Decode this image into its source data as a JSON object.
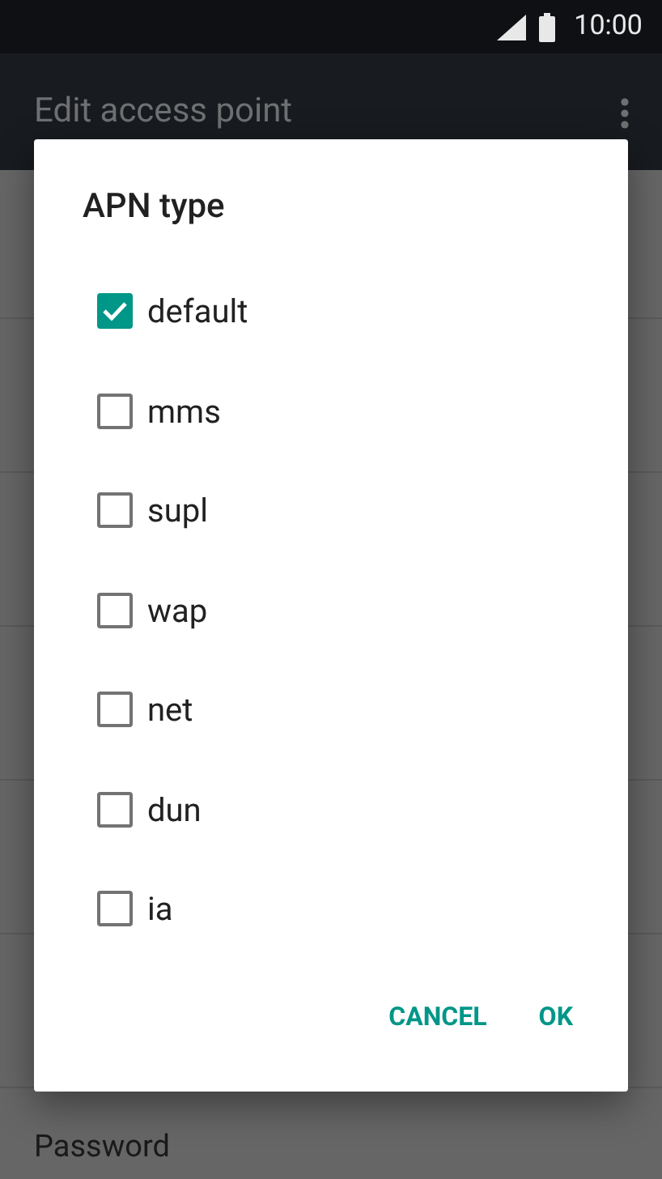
{
  "status_bar": {
    "time": "10:00"
  },
  "toolbar": {
    "title": "Edit access point"
  },
  "background_list": {
    "visible_item": "Password"
  },
  "dialog": {
    "title": "APN type",
    "options": [
      {
        "label": "default",
        "checked": true
      },
      {
        "label": "mms",
        "checked": false
      },
      {
        "label": "supl",
        "checked": false
      },
      {
        "label": "wap",
        "checked": false
      },
      {
        "label": "net",
        "checked": false
      },
      {
        "label": "dun",
        "checked": false
      },
      {
        "label": "ia",
        "checked": false
      }
    ],
    "buttons": [
      "CANCEL",
      "OK"
    ]
  }
}
